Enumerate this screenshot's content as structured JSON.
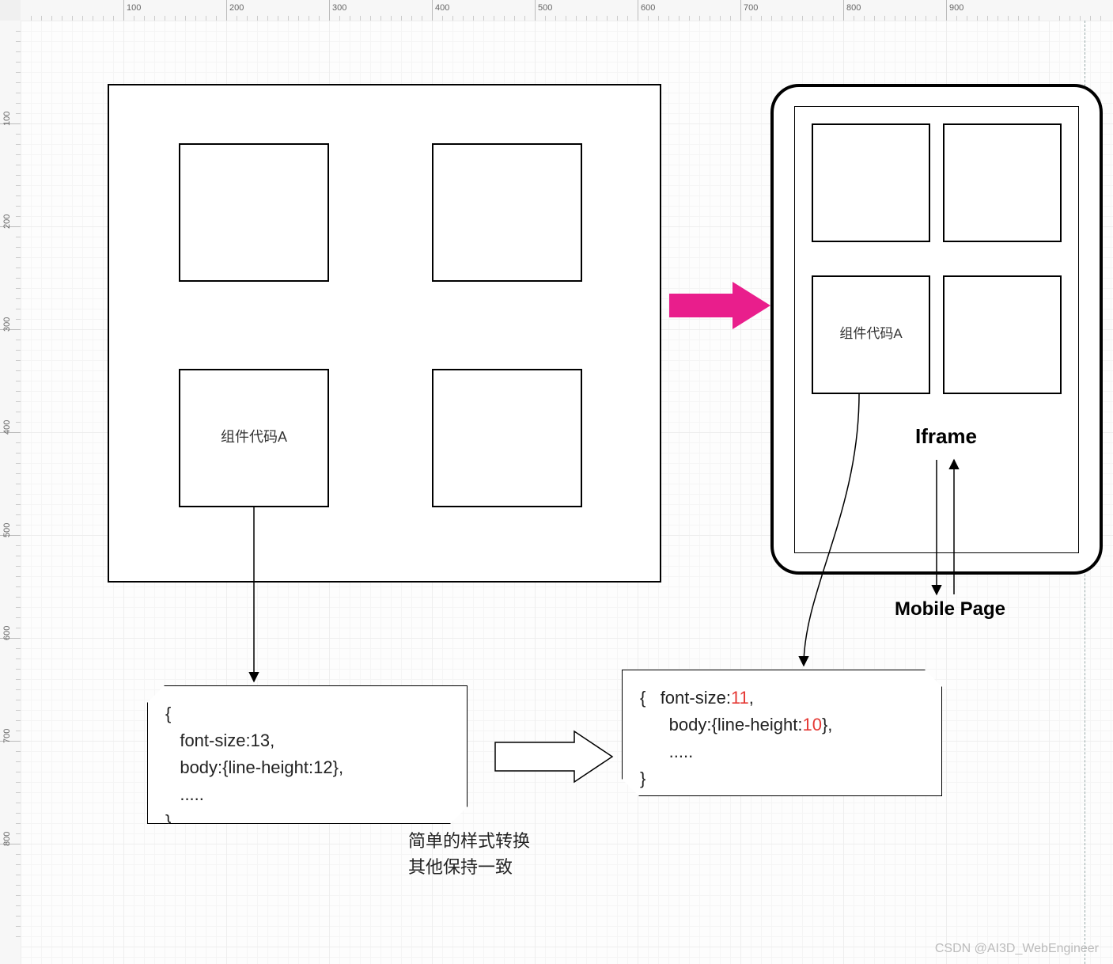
{
  "ruler": {
    "h_ticks": [
      100,
      200,
      300,
      400,
      500,
      600,
      700,
      800,
      900
    ],
    "v_ticks": [
      100,
      200,
      300,
      400,
      500,
      600,
      700,
      800
    ]
  },
  "desktop": {
    "component_label": "组件代码A"
  },
  "mobile": {
    "component_label": "组件代码A",
    "iframe_label": "Iframe",
    "page_label": "Mobile Page"
  },
  "note_left": {
    "line1": "{",
    "line2": "   font-size:13,",
    "line3": "   body:{line-height:12},",
    "line4": "   .....",
    "line5": "}"
  },
  "note_right": {
    "open": "{",
    "fs_key": "   font-size:",
    "fs_val": "11",
    "fs_tail": ",",
    "lh_key": "      body:{line-height:",
    "lh_val": "10",
    "lh_tail": "},",
    "dots": "      .....",
    "close": "}"
  },
  "caption": {
    "line1": "简单的样式转换",
    "line2": "其他保持一致"
  },
  "watermark": "CSDN @AI3D_WebEngineer"
}
